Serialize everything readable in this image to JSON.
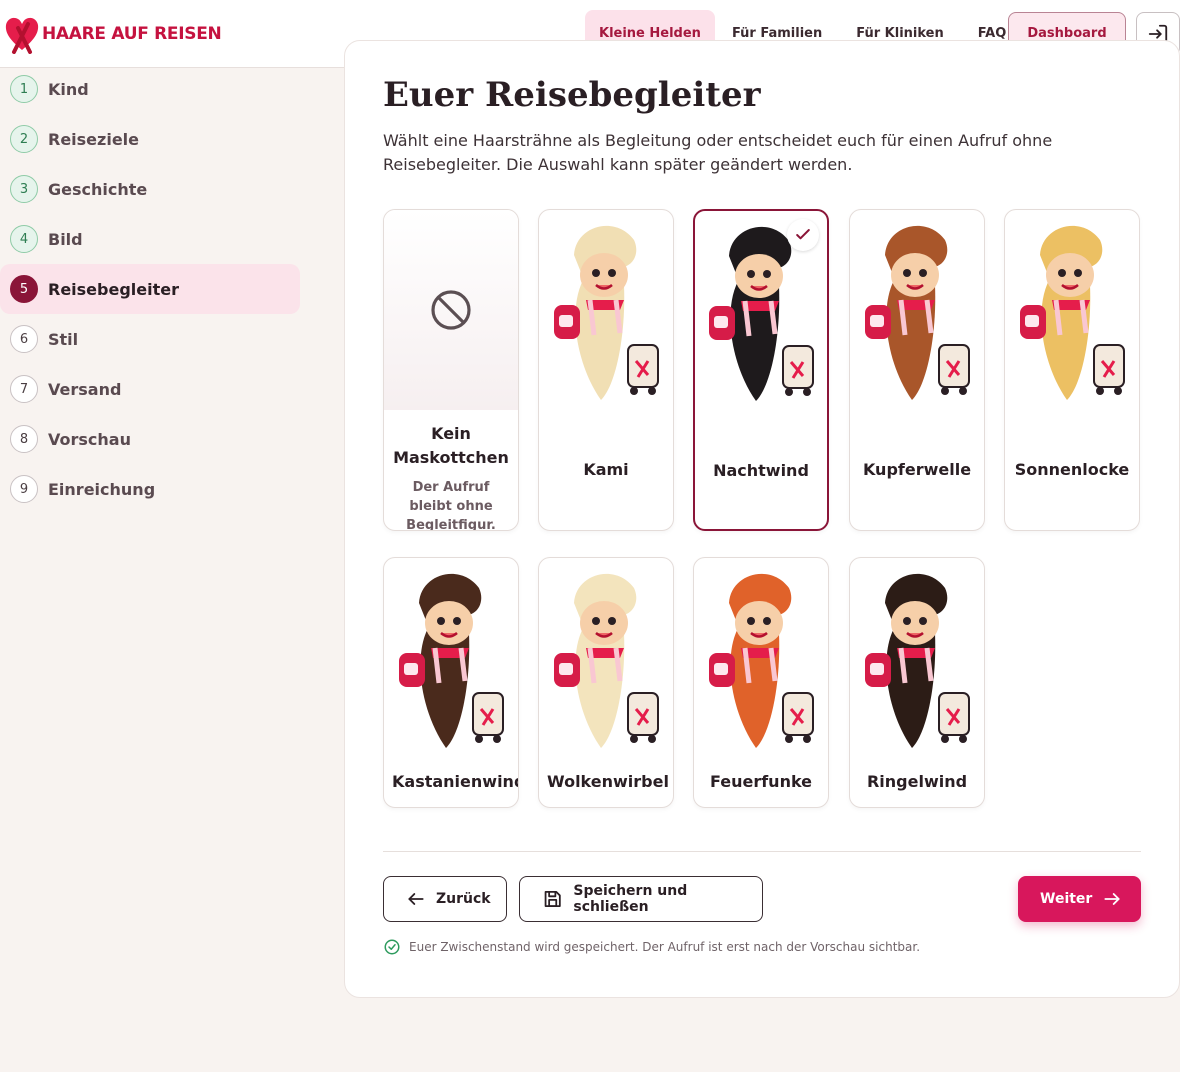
{
  "brand": {
    "name": "HAARE AUF REISEN"
  },
  "nav": {
    "items": [
      {
        "label": "Kleine Helden",
        "active": true
      },
      {
        "label": "Für Familien",
        "active": false
      },
      {
        "label": "Für Kliniken",
        "active": false
      },
      {
        "label": "FAQ",
        "active": false
      }
    ],
    "dashboard_label": "Dashboard"
  },
  "steps": [
    {
      "num": "1",
      "label": "Kind",
      "state": "done"
    },
    {
      "num": "2",
      "label": "Reiseziele",
      "state": "done"
    },
    {
      "num": "3",
      "label": "Geschichte",
      "state": "done"
    },
    {
      "num": "4",
      "label": "Bild",
      "state": "done"
    },
    {
      "num": "5",
      "label": "Reisebegleiter",
      "state": "current"
    },
    {
      "num": "6",
      "label": "Stil",
      "state": "todo"
    },
    {
      "num": "7",
      "label": "Versand",
      "state": "todo"
    },
    {
      "num": "8",
      "label": "Vorschau",
      "state": "todo"
    },
    {
      "num": "9",
      "label": "Einreichung",
      "state": "todo"
    }
  ],
  "page": {
    "title": "Euer Reisebegleiter",
    "intro": "Wählt eine Haarsträhne als Begleitung oder entscheidet euch für einen Aufruf ohne Reisebegleiter. Die Auswahl kann später geändert werden."
  },
  "companions": [
    {
      "name": "Kein Maskottchen",
      "desc": "Der Aufruf bleibt ohne Begleitfigur.",
      "hair": "none",
      "selected": false
    },
    {
      "name": "Kami",
      "hair": "#f1dfb4",
      "selected": false
    },
    {
      "name": "Nachtwind",
      "hair": "#1e1a1c",
      "selected": true
    },
    {
      "name": "Kupferwelle",
      "hair": "#a9562a",
      "selected": false
    },
    {
      "name": "Sonnenlocke",
      "hair": "#ecc063",
      "selected": false
    },
    {
      "name": "Kastanienwind",
      "hair": "#4a2a1c",
      "selected": false
    },
    {
      "name": "Wolkenwirbel",
      "hair": "#f3e4bd",
      "selected": false
    },
    {
      "name": "Feuerfunke",
      "hair": "#e0622a",
      "selected": false
    },
    {
      "name": "Ringelwind",
      "hair": "#2c1c16",
      "selected": false
    }
  ],
  "actions": {
    "back_label": "Zurück",
    "save_label": "Speichern und schließen",
    "next_label": "Weiter"
  },
  "save_note": "Euer Zwischenstand wird gespeichert. Der Aufruf ist erst nach der Vorschau sichtbar.",
  "colors": {
    "brand": "#c5123f",
    "accent": "#d8175c",
    "selected": "#8a1538"
  }
}
